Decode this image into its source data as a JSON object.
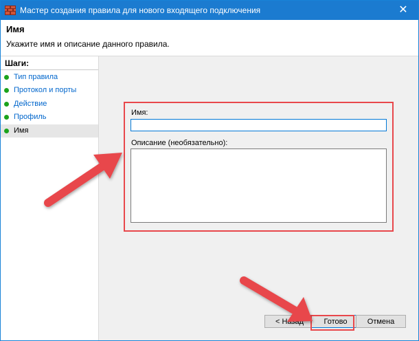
{
  "window": {
    "title": "Мастер создания правила для нового входящего подключения",
    "close_glyph": "✕"
  },
  "header": {
    "title": "Имя",
    "subtitle": "Укажите имя и описание данного правила."
  },
  "sidebar": {
    "steps_label": "Шаги:",
    "items": [
      {
        "label": "Тип правила"
      },
      {
        "label": "Протокол и порты"
      },
      {
        "label": "Действие"
      },
      {
        "label": "Профиль"
      },
      {
        "label": "Имя"
      }
    ]
  },
  "form": {
    "name_label": "Имя:",
    "name_value": "",
    "description_label": "Описание (необязательно):",
    "description_value": ""
  },
  "buttons": {
    "back": "< Назад",
    "finish": "Готово",
    "cancel": "Отмена"
  },
  "colors": {
    "titlebar": "#1b7bd0",
    "highlight": "#e8474b",
    "step_done": "#1ca31c",
    "link": "#0066cc"
  }
}
